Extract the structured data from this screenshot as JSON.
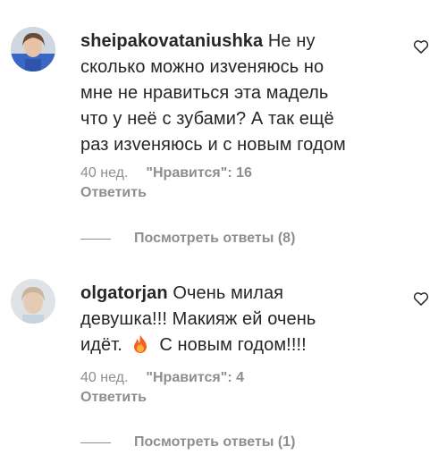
{
  "comments": [
    {
      "username": "sheipakovataniushka",
      "lines": [
        "Не ну",
        "сколько можно изveняюсь но",
        "мне не нравиться эта мадель",
        "что у неё с зубами? А так ещё",
        "раз изveняюсь и с новым годом"
      ],
      "time": "40 нед.",
      "likes": "\"Нравится\": 16",
      "reply_label": "Ответить",
      "view_replies": "Посмотреть ответы (8)",
      "heart_icon": "heart-outline-icon"
    },
    {
      "username": "olgatorjan",
      "lines": [
        "Очень милая",
        "девушка!!! Макияж ей очень",
        "идёт.",
        "С новым годом!!!!"
      ],
      "emoji": "fire-icon",
      "time": "40 нед.",
      "likes": "\"Нравится\": 4",
      "reply_label": "Ответить",
      "view_replies": "Посмотреть ответы (1)",
      "heart_icon": "heart-outline-icon"
    }
  ],
  "colors": {
    "text": "#262626",
    "secondary": "#8e8e8e",
    "fire": "#f4621f"
  }
}
